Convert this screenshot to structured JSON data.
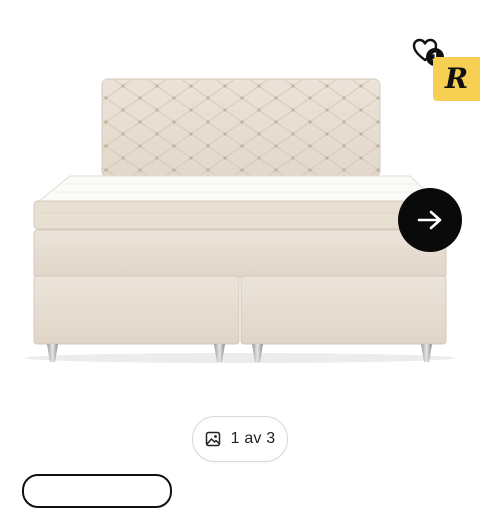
{
  "gallery": {
    "image_counter": "1 av 3",
    "favorite_count": "1",
    "brand_badge": "R"
  },
  "colors": {
    "fabric": "#ece2d6",
    "badge": "#f7cf52",
    "button": "#0a0a0a"
  },
  "icons": [
    "heart-icon",
    "arrow-right-icon",
    "image-icon"
  ]
}
